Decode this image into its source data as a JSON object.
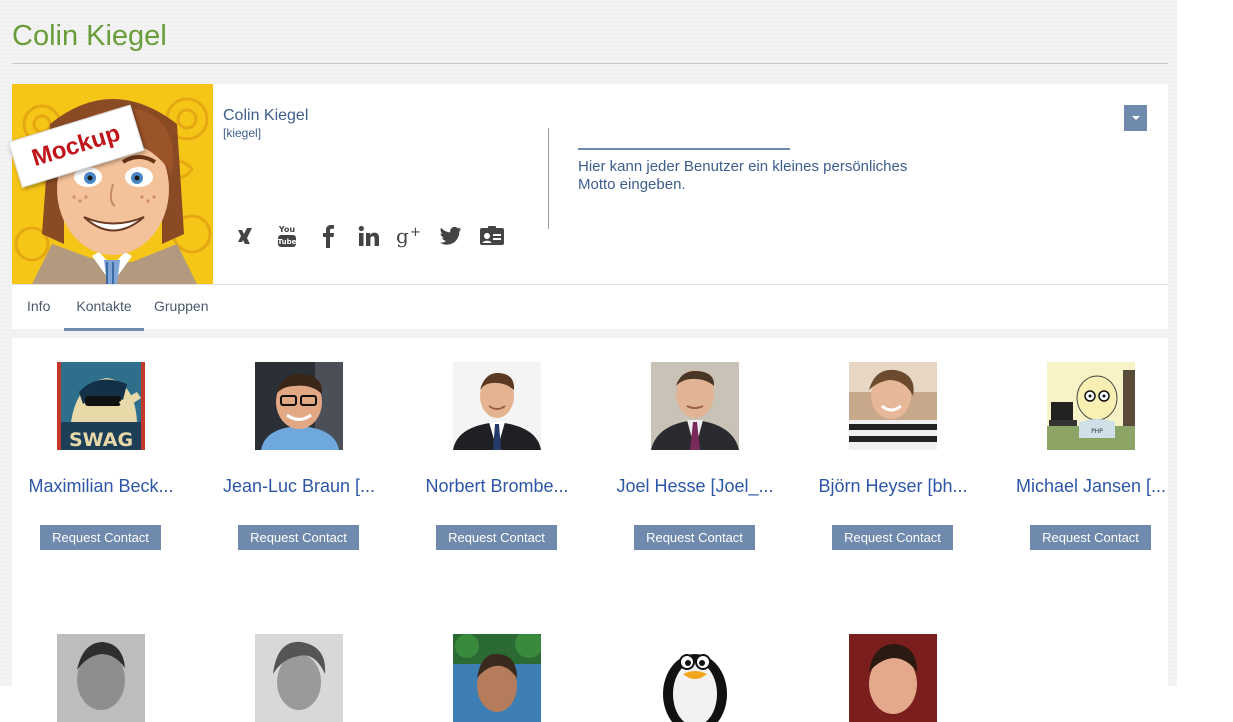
{
  "page": {
    "title": "Colin Kiegel"
  },
  "profile": {
    "name": "Colin Kiegel",
    "username": "[kiegel]",
    "mockup_label": "Mockup",
    "motto": "Hier kann jeder Benutzer ein kleines persönliches Motto eingeben.",
    "social_icons": [
      "xing-icon",
      "youtube-icon",
      "facebook-icon",
      "linkedin-icon",
      "google-plus-icon",
      "twitter-icon",
      "contact-card-icon"
    ]
  },
  "tabs": [
    {
      "label": "Info",
      "active": false
    },
    {
      "label": "Kontakte",
      "active": true
    },
    {
      "label": "Gruppen",
      "active": false
    }
  ],
  "contacts": [
    {
      "name": "Maximilian Beck...",
      "button": "Request Contact"
    },
    {
      "name": "Jean-Luc Braun [...",
      "button": "Request Contact"
    },
    {
      "name": "Norbert Brombe...",
      "button": "Request Contact"
    },
    {
      "name": "Joel Hesse [Joel_...",
      "button": "Request Contact"
    },
    {
      "name": "Björn Heyser [bh...",
      "button": "Request Contact"
    },
    {
      "name": "Michael Jansen [...",
      "button": "Request Contact"
    }
  ],
  "colors": {
    "title_green": "#6a9d3a",
    "link_blue": "#2d57a6",
    "button_slate": "#6f8aad"
  }
}
